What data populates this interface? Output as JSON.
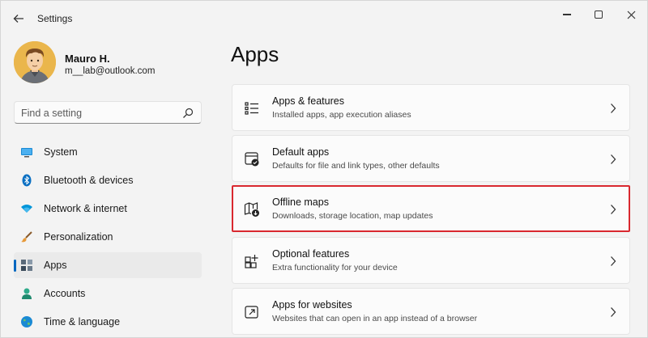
{
  "window": {
    "title": "Settings",
    "back_icon": "back-arrow-icon",
    "controls": [
      "minimize-icon",
      "maximize-icon",
      "close-icon"
    ]
  },
  "profile": {
    "name": "Mauro H.",
    "email": "m__lab@outlook.com"
  },
  "search": {
    "placeholder": "Find a setting",
    "icon": "search-icon"
  },
  "sidebar": {
    "items": [
      {
        "label": "System",
        "icon": "system-icon",
        "icon_color": "#0078d4"
      },
      {
        "label": "Bluetooth & devices",
        "icon": "bluetooth-icon",
        "icon_color": "#0078d4"
      },
      {
        "label": "Network & internet",
        "icon": "network-icon",
        "icon_color": "#0095d9"
      },
      {
        "label": "Personalization",
        "icon": "brush-icon",
        "icon_color": "#c87a3a"
      },
      {
        "label": "Apps",
        "icon": "apps-icon",
        "icon_color": "#4a5a6a",
        "active": true
      },
      {
        "label": "Accounts",
        "icon": "accounts-icon",
        "icon_color": "#2eaa8a"
      },
      {
        "label": "Time & language",
        "icon": "globe-icon",
        "icon_color": "#1a8ad4"
      }
    ]
  },
  "main": {
    "title": "Apps",
    "cards": [
      {
        "title": "Apps & features",
        "subtitle": "Installed apps, app execution aliases",
        "icon": "apps-features-icon"
      },
      {
        "title": "Default apps",
        "subtitle": "Defaults for file and link types, other defaults",
        "icon": "default-apps-icon"
      },
      {
        "title": "Offline maps",
        "subtitle": "Downloads, storage location, map updates",
        "icon": "offline-maps-icon",
        "highlighted": true
      },
      {
        "title": "Optional features",
        "subtitle": "Extra functionality for your device",
        "icon": "optional-features-icon"
      },
      {
        "title": "Apps for websites",
        "subtitle": "Websites that can open in an app instead of a browser",
        "icon": "apps-websites-icon"
      }
    ]
  },
  "colors": {
    "accent": "#0067c0",
    "highlight_border": "#d9282f",
    "background": "#f3f3f3",
    "card": "#fbfbfb"
  }
}
